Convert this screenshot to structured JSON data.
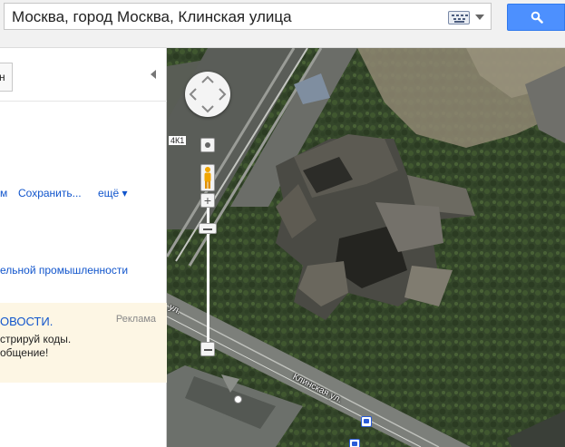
{
  "search": {
    "query": "Москва, город Москва, Клинская улица",
    "keyboard_icon": "keyboard-icon",
    "submit_icon": "magnifier-icon",
    "accent_color": "#4d90fe"
  },
  "panel": {
    "tab_label": "н",
    "actions": {
      "first": "м",
      "save": "Сохранить...",
      "more": "ещё ▾"
    },
    "industry_link": "ельной промышленности",
    "ad": {
      "title": "ОВОСТИ.",
      "label": "Реклама",
      "line1": "стрируй коды.",
      "line2": "общение!"
    }
  },
  "map": {
    "road_upper": "ул.",
    "road_lower": "Клинская ул.",
    "route_badge": "4К1"
  }
}
